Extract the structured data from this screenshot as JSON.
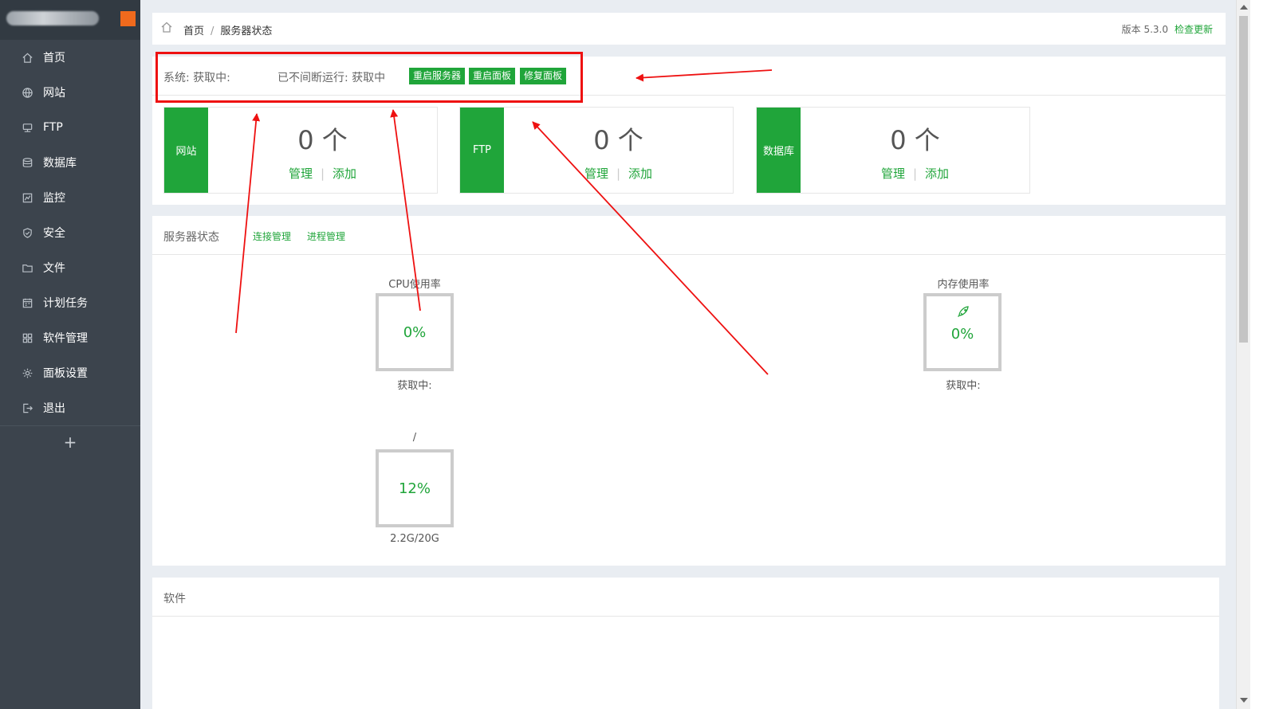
{
  "sidebar": {
    "items": [
      {
        "label": "首页",
        "icon": "home-icon"
      },
      {
        "label": "网站",
        "icon": "globe-icon"
      },
      {
        "label": "FTP",
        "icon": "ftp-icon"
      },
      {
        "label": "数据库",
        "icon": "database-icon"
      },
      {
        "label": "监控",
        "icon": "monitor-icon"
      },
      {
        "label": "安全",
        "icon": "shield-icon"
      },
      {
        "label": "文件",
        "icon": "folder-icon"
      },
      {
        "label": "计划任务",
        "icon": "calendar-icon"
      },
      {
        "label": "软件管理",
        "icon": "grid-icon"
      },
      {
        "label": "面板设置",
        "icon": "gear-icon"
      },
      {
        "label": "退出",
        "icon": "logout-icon"
      }
    ],
    "add_label": "+",
    "accent_color": "#f06a1d"
  },
  "header": {
    "breadcrumb": [
      "首页",
      "服务器状态"
    ],
    "breadcrumb_sep": "/",
    "version_label": "版本 5.3.0",
    "check_update": "检查更新"
  },
  "system": {
    "label": "系统: 获取中:",
    "uptime": "已不间断运行: 获取中",
    "buttons": [
      "重启服务器",
      "重启面板",
      "修复面板"
    ]
  },
  "cards": [
    {
      "tag": "网站",
      "count": "0 个",
      "manage": "管理",
      "sep": "|",
      "add": "添加"
    },
    {
      "tag": "FTP",
      "count": "0 个",
      "manage": "管理",
      "sep": "|",
      "add": "添加"
    },
    {
      "tag": "数据库",
      "count": "0 个",
      "manage": "管理",
      "sep": "|",
      "add": "添加"
    }
  ],
  "server_status": {
    "title": "服务器状态",
    "links": [
      "连接管理",
      "进程管理"
    ],
    "cpu": {
      "title": "CPU使用率",
      "value": "0%",
      "status": "获取中:"
    },
    "memory": {
      "title": "内存使用率",
      "value": "0%",
      "status": "获取中:"
    },
    "disk": {
      "title": "/",
      "value": "12%",
      "status": "2.2G/20G"
    }
  },
  "software": {
    "title": "软件"
  },
  "colors": {
    "green": "#20a53a",
    "sidebar": "#3c444d",
    "annotation": "#ee1111"
  }
}
